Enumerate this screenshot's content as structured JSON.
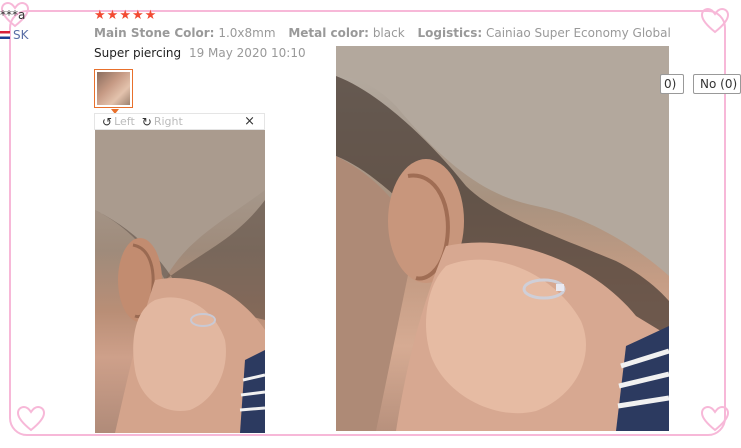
{
  "reviewer": {
    "name": "***a",
    "country": "SK"
  },
  "rating": {
    "stars": 5
  },
  "specs": [
    {
      "key": "Main Stone Color:",
      "value": "1.0x8mm"
    },
    {
      "key": "Metal color:",
      "value": "black"
    },
    {
      "key": "Logistics:",
      "value": "Cainiao Super Economy Global"
    }
  ],
  "review": {
    "text": "Super piercing",
    "date": "19 May 2020 10:10"
  },
  "viewer": {
    "left_label": "Left",
    "right_label": "Right",
    "close_symbol": "×"
  },
  "helpful": {
    "yes_label": "0)",
    "no_label": "No (0)"
  },
  "colors": {
    "frame": "#f7b8d8",
    "star": "#f24a33",
    "thumb_border": "#e8702c"
  }
}
